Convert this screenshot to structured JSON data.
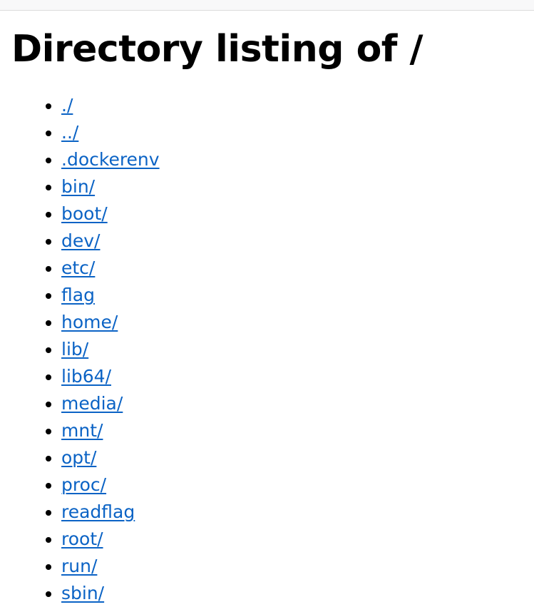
{
  "heading": "Directory listing of /",
  "entries": [
    "./",
    "../",
    ".dockerenv",
    "bin/",
    "boot/",
    "dev/",
    "etc/",
    "flag",
    "home/",
    "lib/",
    "lib64/",
    "media/",
    "mnt/",
    "opt/",
    "proc/",
    "readflag",
    "root/",
    "run/",
    "sbin/"
  ],
  "colors": {
    "link": "#0b63c5",
    "background": "#ffffff"
  }
}
